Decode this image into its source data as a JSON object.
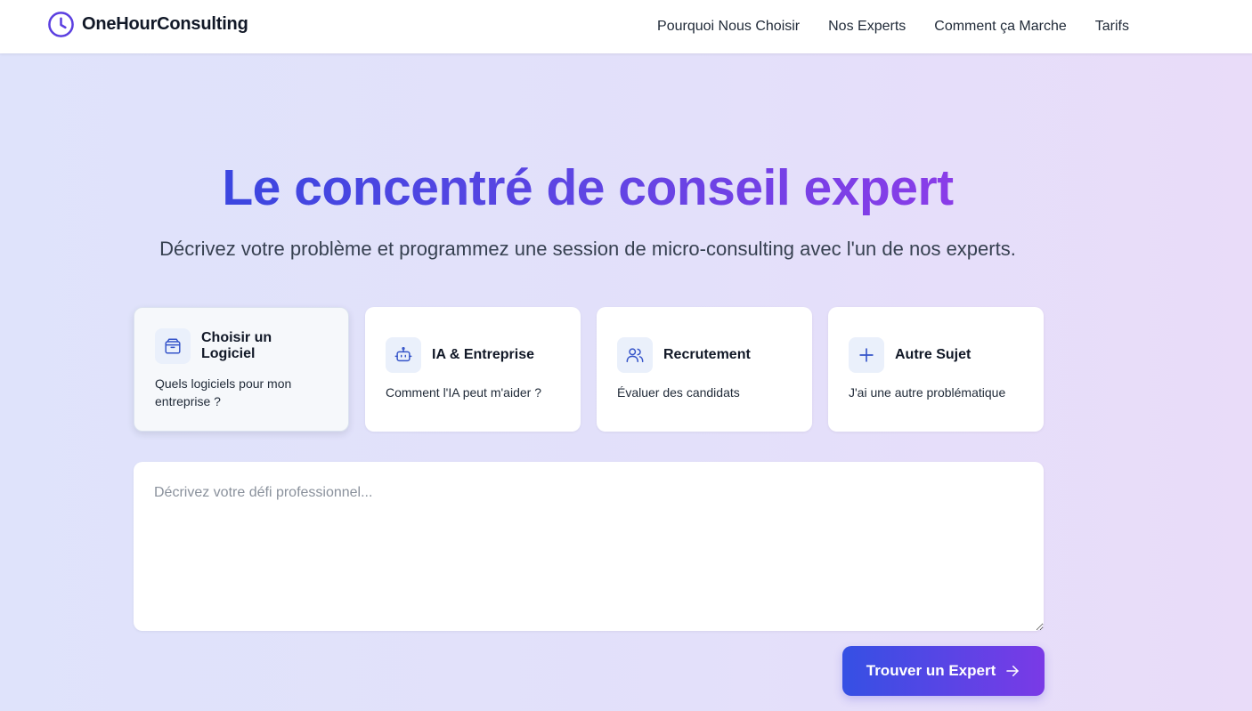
{
  "brand": {
    "name": "OneHourConsulting",
    "icon": "clock-icon",
    "color": "#5b3fe0"
  },
  "nav": {
    "links": [
      "Pourquoi Nous Choisir",
      "Nos Experts",
      "Comment ça Marche",
      "Tarifs"
    ]
  },
  "hero": {
    "title": "Le concentré de conseil expert",
    "subtitle": "Décrivez votre problème et programmez une session de micro-consulting avec l'un de nos experts."
  },
  "topics": [
    {
      "title": "Choisir un Logiciel",
      "description": "Quels logiciels pour mon entreprise ?",
      "icon": "box-icon",
      "selected": true
    },
    {
      "title": "IA & Entreprise",
      "description": "Comment l'IA peut m'aider ?",
      "icon": "robot-icon",
      "selected": false
    },
    {
      "title": "Recrutement",
      "description": "Évaluer des candidats",
      "icon": "users-icon",
      "selected": false
    },
    {
      "title": "Autre Sujet",
      "description": "J'ai une autre problématique",
      "icon": "plus-icon",
      "selected": false
    }
  ],
  "form": {
    "placeholder": "Décrivez votre défi professionnel...",
    "value": "",
    "submit_label": "Trouver un Expert",
    "submit_icon": "arrow-right-icon"
  },
  "colors": {
    "accent_start": "#3b46e0",
    "accent_end": "#8a3ce8",
    "icon_blue": "#3554c9"
  }
}
